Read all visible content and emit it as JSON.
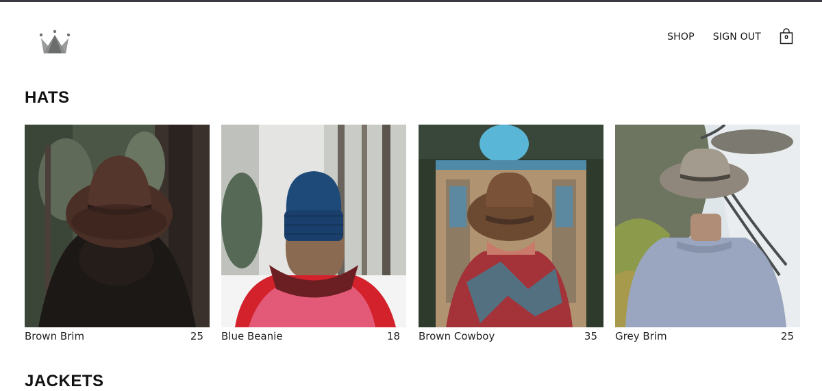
{
  "nav": {
    "shop": "SHOP",
    "sign_out": "SIGN OUT",
    "cart_count": "0"
  },
  "sections": [
    {
      "title": "HATS",
      "items": [
        {
          "name": "Brown Brim",
          "price": "25"
        },
        {
          "name": "Blue Beanie",
          "price": "18"
        },
        {
          "name": "Brown Cowboy",
          "price": "35"
        },
        {
          "name": "Grey Brim",
          "price": "25"
        }
      ]
    },
    {
      "title": "JACKETS"
    }
  ],
  "colors": {
    "top_rule": "#3a3a44",
    "logo": "#808282",
    "text": "#111111"
  }
}
